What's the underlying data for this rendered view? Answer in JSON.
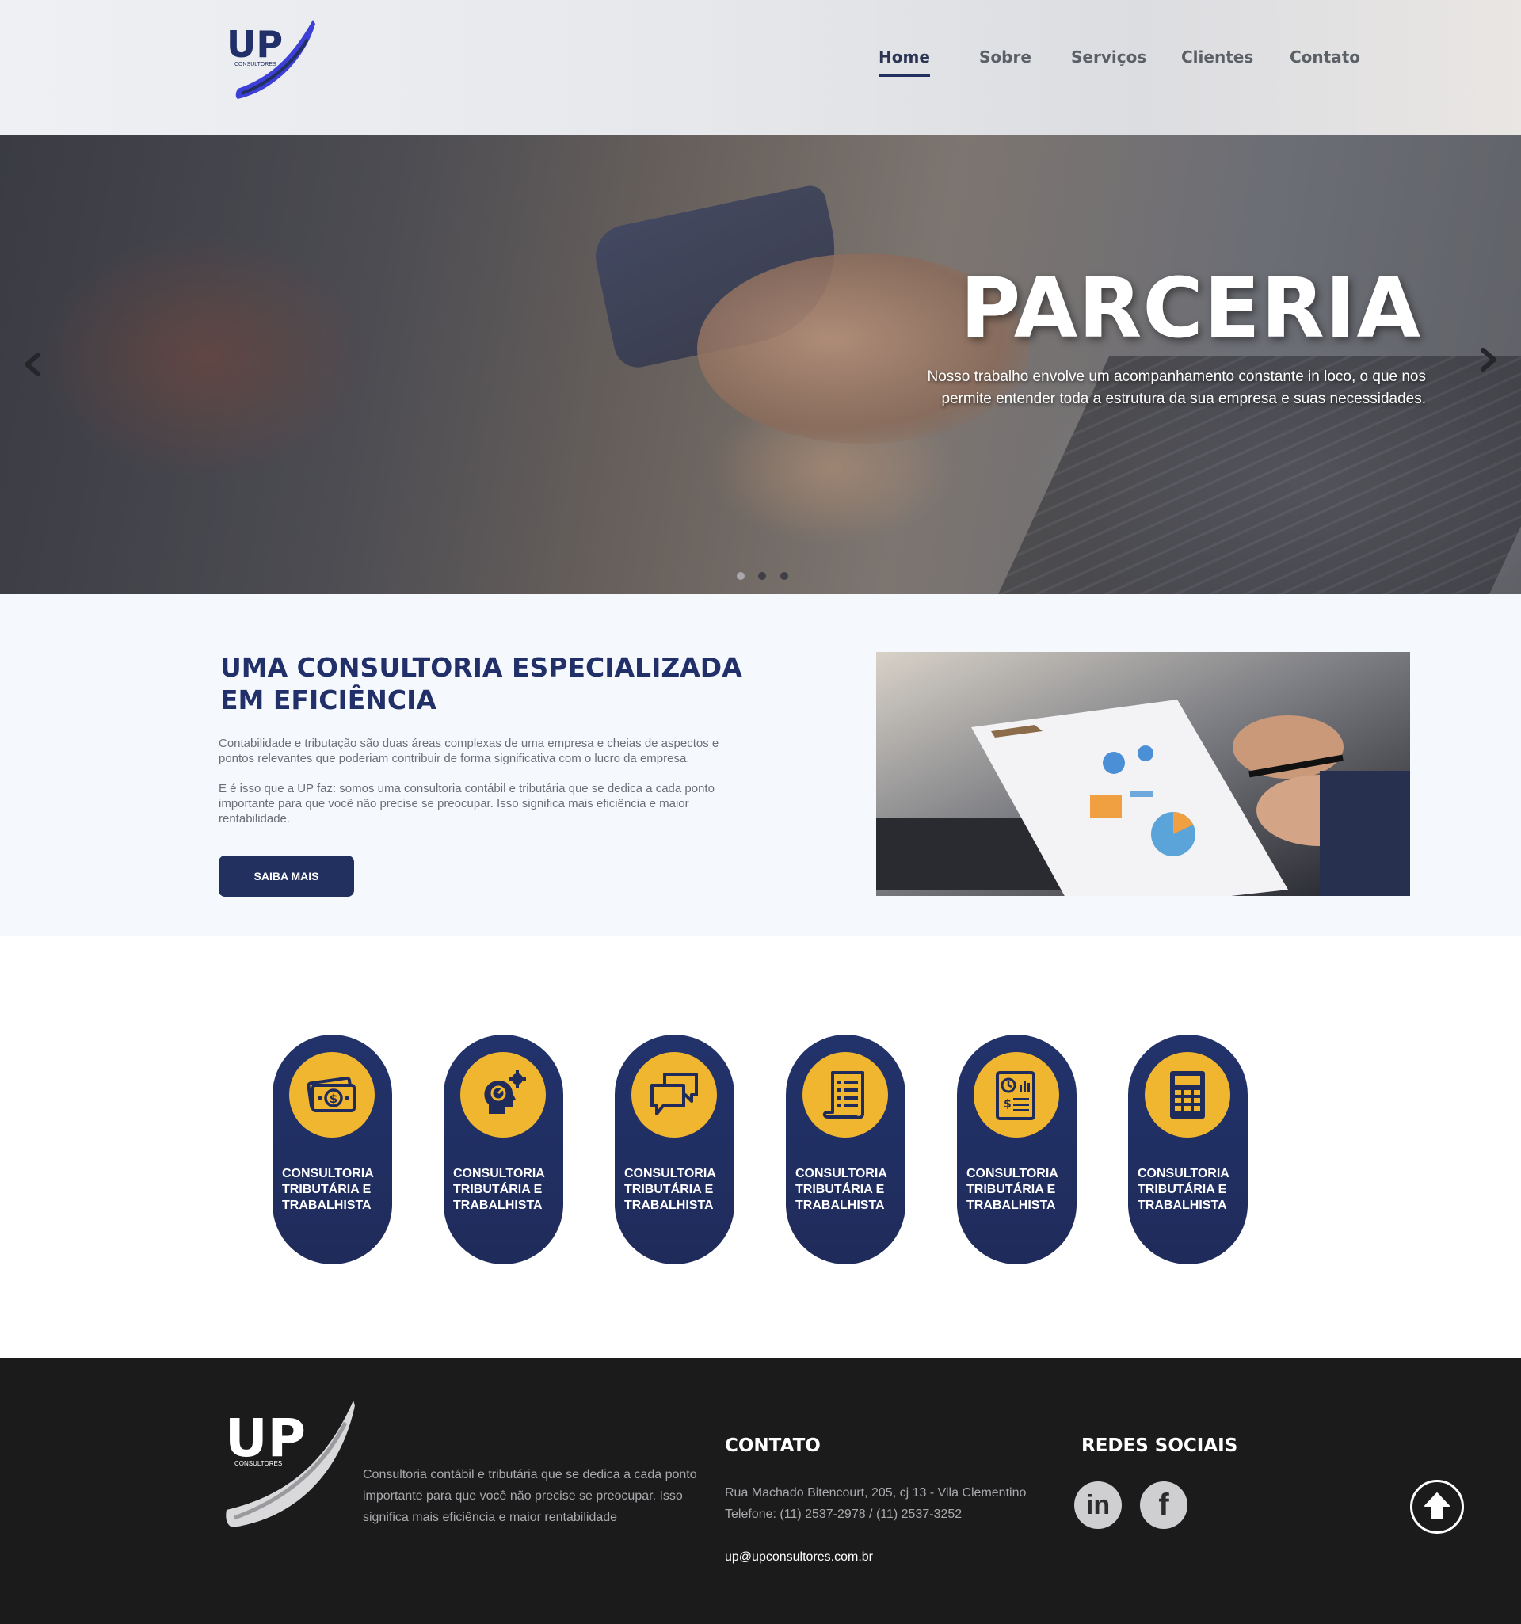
{
  "brand": {
    "logo_text": "UP",
    "logo_subtext": "CONSULTORES",
    "primary_color": "#22305f",
    "accent_color": "#f1b62f",
    "logo_swoosh_color": "#3d3fd9"
  },
  "nav": {
    "items": [
      {
        "label": "Home",
        "active": true
      },
      {
        "label": "Sobre",
        "active": false
      },
      {
        "label": "Serviços",
        "active": false
      },
      {
        "label": "Clientes",
        "active": false
      },
      {
        "label": "Contato",
        "active": false
      }
    ]
  },
  "hero": {
    "title": "PARCERIA",
    "text_line1": "Nosso trabalho envolve um acompanhamento constante in loco, o que nos",
    "text_line2": "permite entender toda a estrutura da sua empresa e suas necessidades.",
    "prev_icon": "chevron-left-icon",
    "next_icon": "chevron-right-icon",
    "slide_count": 3,
    "active_slide": 1
  },
  "about": {
    "title_line1": "UMA CONSULTORIA ESPECIALIZADA",
    "title_line2": "EM EFICIÊNCIA",
    "p1_line1": "Contabilidade e tributação são duas áreas complexas de uma empresa e cheias de aspectos e",
    "p1_line2": "pontos relevantes que poderiam contribuir de forma significativa com o lucro da empresa.",
    "p2_line1": "E é isso que a UP faz: somos uma consultoria contábil e tributária que se dedica a cada ponto",
    "p2_line2": "importante para que você não precise se preocupar. Isso significa mais eficiência e maior",
    "p2_line3": "rentabilidade.",
    "button_label": "SAIBA MAIS"
  },
  "services": {
    "items": [
      {
        "icon": "money-icon",
        "label_line1": "CONSULTORIA",
        "label_line2": "TRIBUTÁRIA E",
        "label_line3": "TRABALHISTA"
      },
      {
        "icon": "head-gear-icon",
        "label_line1": "CONSULTORIA",
        "label_line2": "TRIBUTÁRIA E",
        "label_line3": "TRABALHISTA"
      },
      {
        "icon": "chat-bubbles-icon",
        "label_line1": "CONSULTORIA",
        "label_line2": "TRIBUTÁRIA E",
        "label_line3": "TRABALHISTA"
      },
      {
        "icon": "document-list-icon",
        "label_line1": "CONSULTORIA",
        "label_line2": "TRIBUTÁRIA E",
        "label_line3": "TRABALHISTA"
      },
      {
        "icon": "report-chart-icon",
        "label_line1": "CONSULTORIA",
        "label_line2": "TRIBUTÁRIA E",
        "label_line3": "TRABALHISTA"
      },
      {
        "icon": "calculator-icon",
        "label_line1": "CONSULTORIA",
        "label_line2": "TRIBUTÁRIA E",
        "label_line3": "TRABALHISTA"
      }
    ]
  },
  "footer": {
    "logo_text": "UP",
    "logo_subtext": "CONSULTORES",
    "desc_line1": "Consultoria contábil e tributária que se dedica a cada ponto",
    "desc_line2": "importante para que você não precise se preocupar. Isso",
    "desc_line3": "significa mais eficiência e maior rentabilidade",
    "contact_title": "CONTATO",
    "address": "Rua Machado Bitencourt, 205, cj 13 - Vila Clementino",
    "phone": "Telefone: (11) 2537-2978 / (11) 2537-3252",
    "email": "up@upconsultores.com.br",
    "social_title": "REDES SOCIAIS",
    "social": [
      {
        "name": "linkedin-icon",
        "glyph": "in"
      },
      {
        "name": "facebook-icon",
        "glyph": "f"
      }
    ],
    "back_to_top_icon": "arrow-up-icon"
  }
}
